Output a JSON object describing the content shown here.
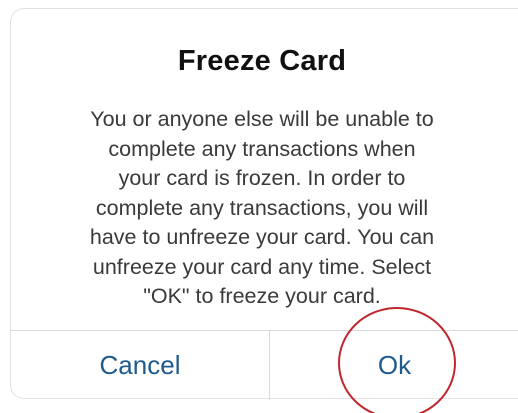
{
  "dialog": {
    "title": "Freeze Card",
    "message_lines": [
      "You or anyone else will be unable to",
      "complete any transactions when",
      "your card is frozen. In order to",
      "complete any transactions, you will",
      "have to unfreeze your card. You can",
      "unfreeze your card any time. Select",
      "\"OK\" to freeze your card."
    ],
    "cancel_label": "Cancel",
    "ok_label": "Ok"
  },
  "colors": {
    "button_text": "#1e5a8c",
    "annotation_circle": "#c0262d"
  }
}
